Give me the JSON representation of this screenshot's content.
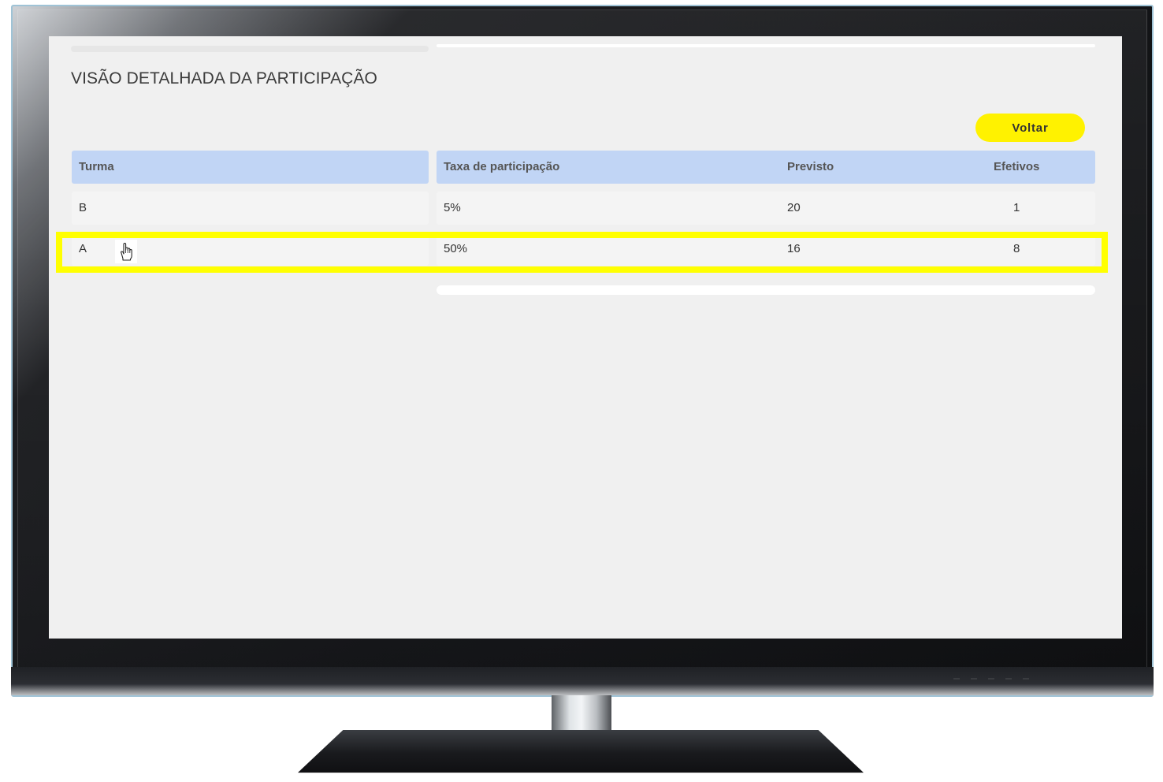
{
  "page": {
    "title": "VISÃO DETALHADA DA PARTICIPAÇÃO",
    "back_button_label": "Voltar",
    "back_button_color": "#fff200",
    "header_color": "#c1d5f5",
    "highlight_color": "#ffff00"
  },
  "table": {
    "columns": [
      "Turma",
      "Taxa de participação",
      "Previsto",
      "Efetivos"
    ],
    "rows": [
      {
        "turma": "B",
        "taxa": "5%",
        "previsto": "20",
        "efetivos": "1"
      },
      {
        "turma": "A",
        "taxa": "50%",
        "previsto": "16",
        "efetivos": "8"
      }
    ],
    "highlighted_row": "A"
  },
  "cursor": {
    "icon": "hand-pointer-icon"
  }
}
